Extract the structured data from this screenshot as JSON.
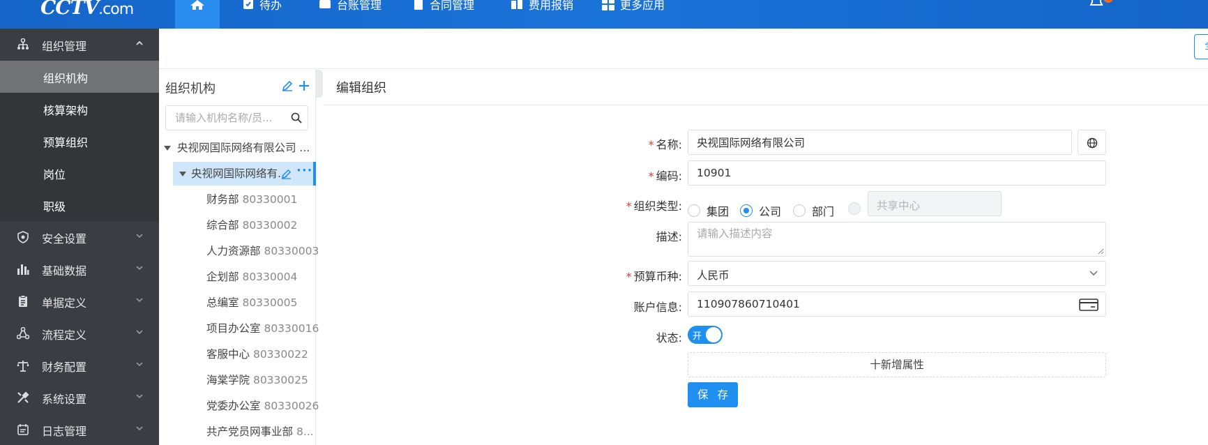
{
  "brand": {
    "logo_text": "CCTV",
    "logo_suffix": ".com"
  },
  "topnav": {
    "items": [
      {
        "label": "待办",
        "icon": "todo-icon"
      },
      {
        "label": "台账管理",
        "icon": "ledger-icon"
      },
      {
        "label": "合同管理",
        "icon": "contract-icon"
      },
      {
        "label": "费用报销",
        "icon": "expense-icon"
      },
      {
        "label": "更多应用",
        "icon": "apps-icon"
      }
    ]
  },
  "sidebar": {
    "group_open": {
      "label": "组织管理",
      "icon": "org-tree-icon"
    },
    "sub_items": [
      "组织机构",
      "核算架构",
      "预算组织",
      "岗位",
      "职级"
    ],
    "groups": [
      {
        "label": "安全设置",
        "icon": "shield-gear-icon"
      },
      {
        "label": "基础数据",
        "icon": "bar-chart-icon"
      },
      {
        "label": "单据定义",
        "icon": "clipboard-icon"
      },
      {
        "label": "流程定义",
        "icon": "flow-icon"
      },
      {
        "label": "财务配置",
        "icon": "scale-icon"
      },
      {
        "label": "系统设置",
        "icon": "tools-icon"
      },
      {
        "label": "日志管理",
        "icon": "log-icon"
      }
    ]
  },
  "strip": {
    "button_label": "全"
  },
  "tree": {
    "title": "组织机构",
    "search_placeholder": "请输入机构名称/员...",
    "root": "央视网国际网络有限公司 ...",
    "selected": "央视网国际网络有...",
    "children": [
      {
        "name": "财务部",
        "code": "80330001"
      },
      {
        "name": "综合部",
        "code": "80330002"
      },
      {
        "name": "人力资源部",
        "code": "80330003"
      },
      {
        "name": "企划部",
        "code": "80330004"
      },
      {
        "name": "总编室",
        "code": "80330005"
      },
      {
        "name": "项目办公室",
        "code": "80330016"
      },
      {
        "name": "客服中心",
        "code": "80330022"
      },
      {
        "name": "海棠学院",
        "code": "80330025"
      },
      {
        "name": "党委办公室",
        "code": "80330026"
      },
      {
        "name": "共产党员网事业部",
        "code": "8..."
      }
    ]
  },
  "form": {
    "title": "编辑组织",
    "name_label": "名称:",
    "name_value": "央视国际网络有限公司",
    "code_label": "编码:",
    "code_value": "10901",
    "type_label": "组织类型:",
    "type_options": [
      "集团",
      "公司",
      "部门"
    ],
    "type_selected": "公司",
    "share_center": "共享中心",
    "desc_label": "描述:",
    "desc_placeholder": "请输入描述内容",
    "currency_label": "预算币种:",
    "currency_value": "人民币",
    "account_label": "账户信息:",
    "account_value": "110907860710401",
    "status_label": "状态:",
    "status_on": "开",
    "add_attr": "十新增属性",
    "save": "保 存"
  },
  "colors": {
    "primary": "#1f8ff0",
    "sidebar": "#3a3d42",
    "topbar": "#1a73d9",
    "required": "#e53935"
  }
}
